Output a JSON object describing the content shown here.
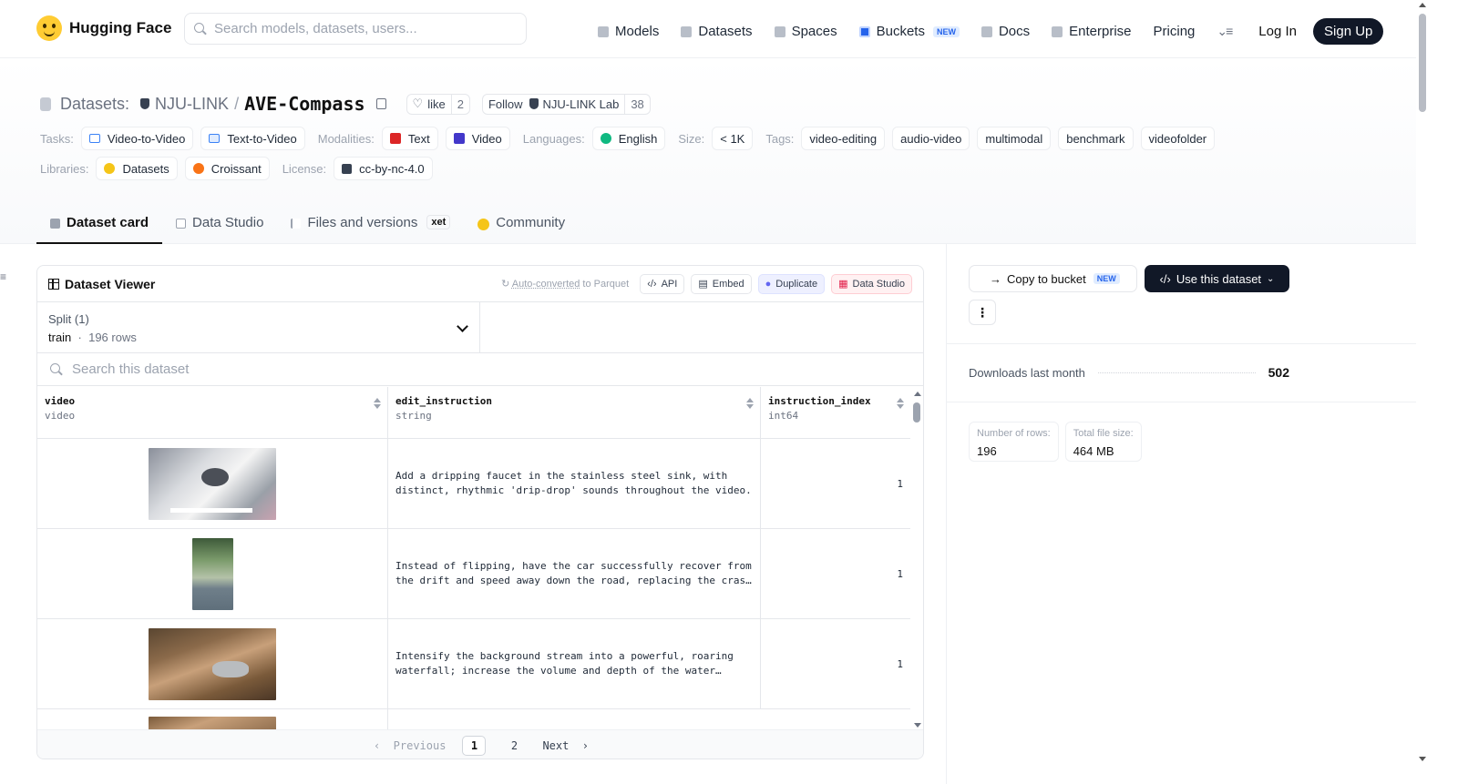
{
  "header": {
    "brand": "Hugging Face",
    "search_placeholder": "Search models, datasets, users...",
    "nav": [
      {
        "label": "Models",
        "icon": "cube-icon"
      },
      {
        "label": "Datasets",
        "icon": "database-icon"
      },
      {
        "label": "Spaces",
        "icon": "grid-icon"
      },
      {
        "label": "Buckets",
        "icon": "bucket-icon",
        "badge": "NEW"
      },
      {
        "label": "Docs",
        "icon": "book-icon"
      },
      {
        "label": "Enterprise",
        "icon": "enterprise-icon"
      },
      {
        "label": "Pricing"
      }
    ],
    "login": "Log In",
    "signup": "Sign Up"
  },
  "repo": {
    "section": "Datasets:",
    "org": "NJU-LINK",
    "sep": "/",
    "name": "AVE-Compass",
    "like_label": "like",
    "like_count": "2",
    "follow_label": "Follow",
    "follow_org": "NJU-LINK Lab",
    "follow_count": "38"
  },
  "tags": {
    "tasks_label": "Tasks:",
    "tasks": [
      "Video-to-Video",
      "Text-to-Video"
    ],
    "modalities_label": "Modalities:",
    "modalities": [
      "Text",
      "Video"
    ],
    "languages_label": "Languages:",
    "languages": [
      "English"
    ],
    "size_label": "Size:",
    "size": "< 1K",
    "tags_label": "Tags:",
    "tags": [
      "video-editing",
      "audio-video",
      "multimodal",
      "benchmark",
      "videofolder"
    ],
    "libraries_label": "Libraries:",
    "libraries": [
      "Datasets",
      "Croissant"
    ],
    "license_label": "License:",
    "license": "cc-by-nc-4.0"
  },
  "tabs": [
    {
      "label": "Dataset card",
      "active": true
    },
    {
      "label": "Data Studio"
    },
    {
      "label": "Files and versions",
      "badge": "xet"
    },
    {
      "label": "Community"
    }
  ],
  "viewer": {
    "title": "Dataset Viewer",
    "auto_prefix": "Auto-converted",
    "auto_suffix": " to Parquet",
    "buttons": [
      "API",
      "Embed",
      "Duplicate",
      "Data Studio"
    ],
    "split_label": "Split (1)",
    "split_name": "train",
    "split_rows": "196 rows",
    "search_placeholder": "Search this dataset",
    "columns": [
      {
        "name": "video",
        "type": "video"
      },
      {
        "name": "edit_instruction",
        "type": "string"
      },
      {
        "name": "instruction_index",
        "type": "int64"
      }
    ],
    "rows": [
      {
        "instruction": "Add a dripping faucet in the stainless steel sink, with distinct, rhythmic 'drip-drop' sounds throughout the video.",
        "index": "1"
      },
      {
        "instruction": "Instead of flipping, have the car successfully recover from the drift and speed away down the road, replacing the crash sound.",
        "index": "1"
      },
      {
        "instruction": "Intensify the background stream into a powerful, roaring waterfall; increase the volume and depth of the water sound.",
        "index": "1"
      }
    ],
    "pager": {
      "prev": "Previous",
      "pages": [
        "1",
        "2"
      ],
      "next": "Next"
    }
  },
  "sidebar": {
    "copy_label": "Copy to bucket",
    "copy_badge": "NEW",
    "use_label": "Use this dataset",
    "downloads_label": "Downloads last month",
    "downloads_value": "502",
    "rows_label": "Number of rows:",
    "rows_value": "196",
    "size_label": "Total file size:",
    "size_value": "464 MB"
  }
}
